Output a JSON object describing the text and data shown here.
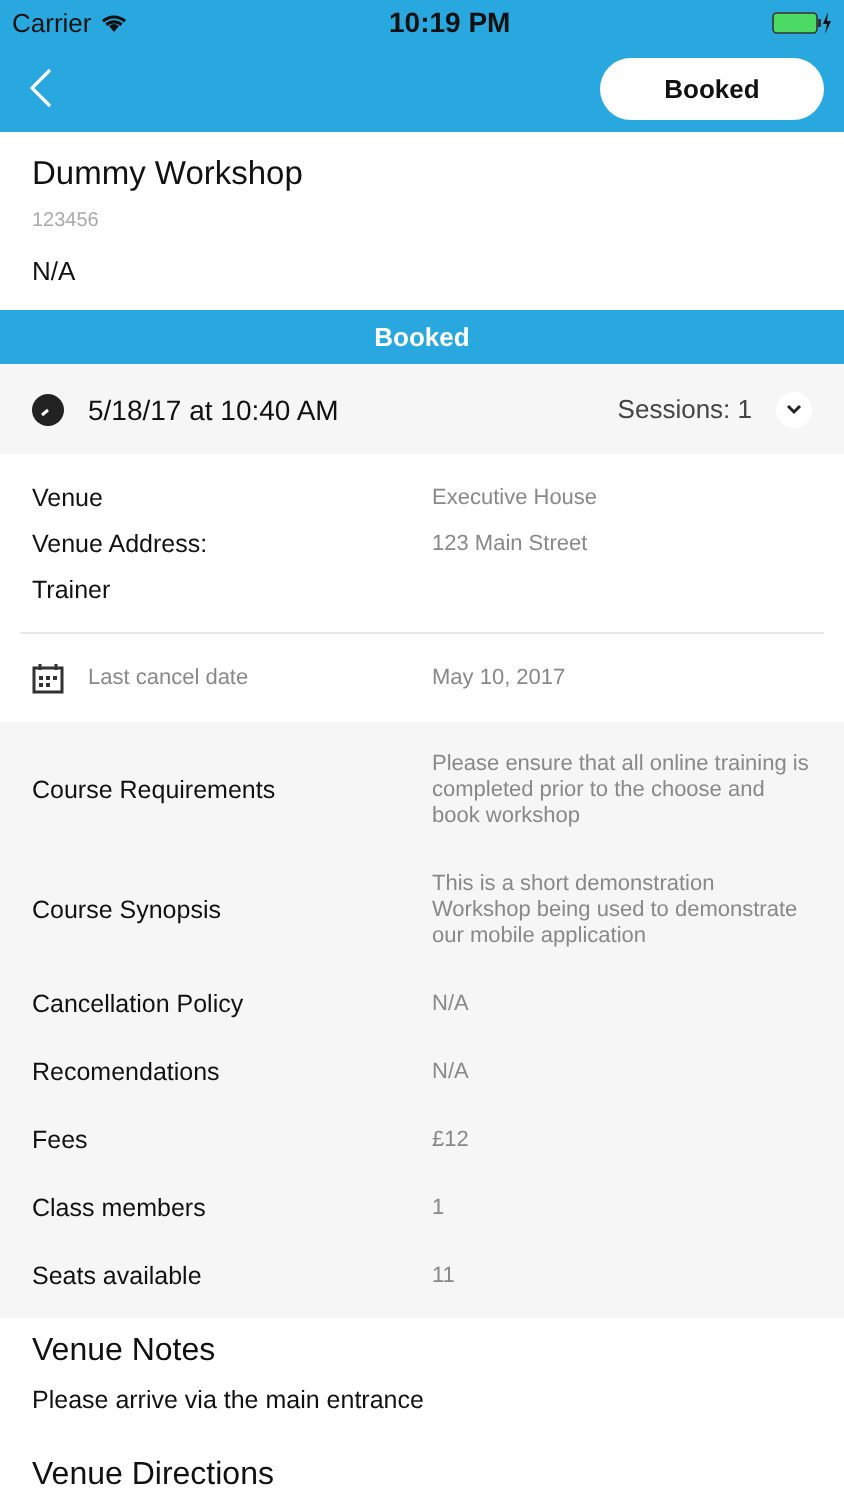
{
  "status_bar": {
    "carrier": "Carrier",
    "time": "10:19 PM"
  },
  "nav": {
    "action": "Booked"
  },
  "header": {
    "title": "Dummy Workshop",
    "code": "123456",
    "subtitle": "N/A"
  },
  "status_banner": "Booked",
  "session": {
    "datetime": "5/18/17 at 10:40 AM",
    "sessions": "Sessions: 1",
    "expanded": false
  },
  "venue_rows": [
    {
      "label": "Venue",
      "value": "Executive House"
    },
    {
      "label": "Venue Address:",
      "value": "123 Main Street"
    },
    {
      "label": "Trainer"
    }
  ],
  "cancel": {
    "label": "Last cancel date",
    "value": "May 10, 2017"
  },
  "details": [
    {
      "label": "Course Requirements",
      "value": "Please ensure that all online training is completed prior to the choose and book workshop"
    },
    {
      "label": "Course Synopsis",
      "value": "This is a short demonstration Workshop being used to demonstrate our mobile application"
    },
    {
      "label": "Cancellation Policy",
      "value": "N/A"
    },
    {
      "label": "Recomendations",
      "value": "N/A"
    },
    {
      "label": "Fees",
      "value": "£12"
    },
    {
      "label": "Class members",
      "value": "1"
    },
    {
      "label": "Seats available",
      "value": "11"
    }
  ],
  "sections": [
    {
      "title": "Venue Notes",
      "body": "Please arrive via the main entrance"
    },
    {
      "title": "Venue Directions"
    }
  ]
}
